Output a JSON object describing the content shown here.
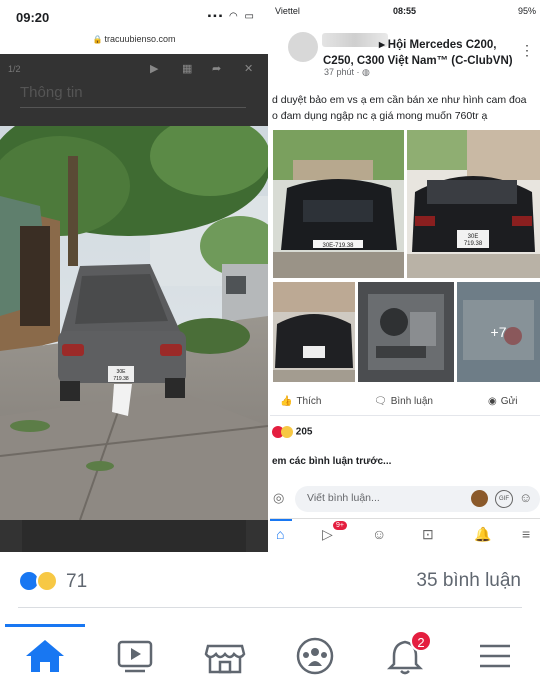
{
  "left_phone": {
    "status_time": "09:20",
    "url": "tracuubienso.com",
    "pager": "1/2",
    "title": "Thông tin",
    "plate": "30E\n719.38"
  },
  "right_phone": {
    "carrier": "Viettel",
    "status_time": "08:55",
    "battery": "95%",
    "group_name": "Hội Mercedes C200, C250, C300 Việt Nam™ (C-ClubVN)",
    "post_age": "37 phút",
    "post_text": "d duyệt bảo em vs ạ em cần bán xe như hình cam đoa o đam dụng ngập nc ạ giá mong muốn 760tr ạ",
    "plate_front": "30E-719.38",
    "plate_rear": "30E\n719.38",
    "more_photos": "+7",
    "actions": {
      "like": "Thích",
      "comment": "Bình luận",
      "share": "Gửi"
    },
    "reaction_count": "205",
    "view_previous": "em các bình luận trước...",
    "comment_placeholder": "Viết bình luận...",
    "gif_label": "GIF",
    "video_badge": "9+"
  },
  "bottom": {
    "reaction_count": "71",
    "comment_count": "35 bình luận",
    "notification_badge": "2",
    "accent": "#1877f2",
    "badge_color": "#e41e3f"
  }
}
